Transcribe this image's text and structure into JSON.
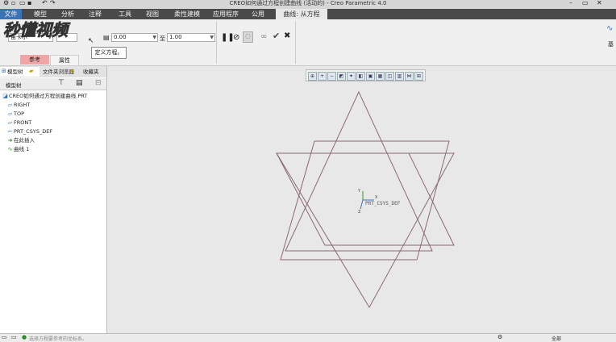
{
  "app": {
    "title": "CREO如何通过方程创建曲线 (活动的) - Creo Parametric 4.0"
  },
  "quick_access": {
    "icons": [
      "new-icon",
      "open-icon",
      "save-icon",
      "undo-icon",
      "redo-icon"
    ]
  },
  "window_controls": {
    "minimize": "–",
    "restore": "▭",
    "close": "✕"
  },
  "menu": {
    "tabs": [
      "文件",
      "模型",
      "分析",
      "注释",
      "工具",
      "视图",
      "柔性建模",
      "应用程序",
      "公用"
    ],
    "context_tab": "曲线: 从方程"
  },
  "ribbon": {
    "coord_type": "笛卡尔",
    "from_value": "0.00",
    "to_label": "至",
    "to_value": "1.00",
    "subtabs": [
      "参考",
      "属性"
    ],
    "tooltip": "定义方程。",
    "right_label": "基"
  },
  "logo_text": "秒懂视频",
  "panel": {
    "tabs": [
      "模型树",
      "文件夹浏览器",
      "收藏夹"
    ],
    "header": "模型树",
    "tree": [
      {
        "label": "CREO如何通过方程创建曲线.PRT",
        "icon": "part-icon"
      },
      {
        "label": "RIGHT",
        "icon": "datum-plane-icon"
      },
      {
        "label": "TOP",
        "icon": "datum-plane-icon"
      },
      {
        "label": "FRONT",
        "icon": "datum-plane-icon"
      },
      {
        "label": "PRT_CSYS_DEF",
        "icon": "csys-icon"
      },
      {
        "label": "在此插入",
        "icon": "insert-arrow-icon"
      },
      {
        "label": "曲线 1",
        "icon": "curve-icon"
      }
    ]
  },
  "canvas": {
    "csys_label": "PRT_CSYS_DEF",
    "axis_x": "X",
    "axis_y": "Y",
    "axis_z": "Z",
    "curve_color": "#8a6a74"
  },
  "status": {
    "message": "选择方程要参考的坐标系。",
    "right_text": "全部"
  }
}
